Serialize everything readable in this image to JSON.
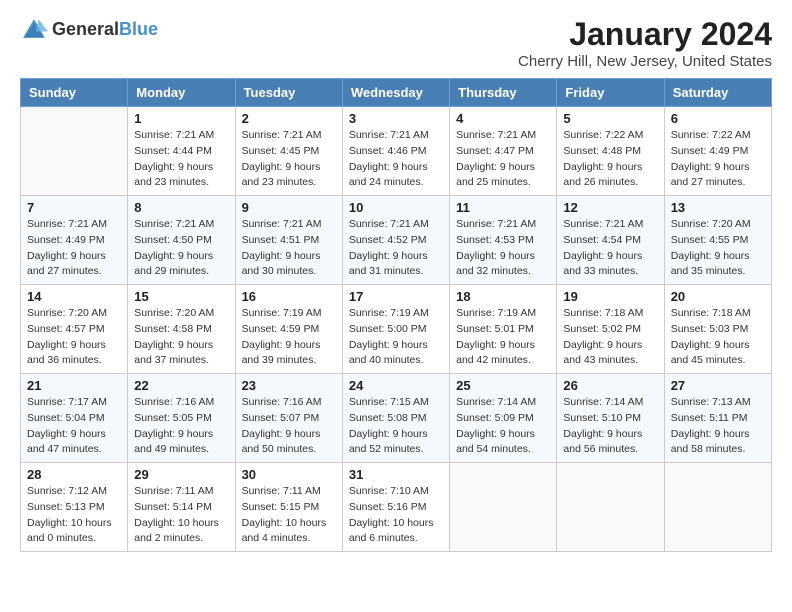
{
  "header": {
    "logo_general": "General",
    "logo_blue": "Blue",
    "title": "January 2024",
    "subtitle": "Cherry Hill, New Jersey, United States"
  },
  "days_of_week": [
    "Sunday",
    "Monday",
    "Tuesday",
    "Wednesday",
    "Thursday",
    "Friday",
    "Saturday"
  ],
  "weeks": [
    [
      {
        "day": "",
        "sunrise": "",
        "sunset": "",
        "daylight": ""
      },
      {
        "day": "1",
        "sunrise": "Sunrise: 7:21 AM",
        "sunset": "Sunset: 4:44 PM",
        "daylight": "Daylight: 9 hours and 23 minutes."
      },
      {
        "day": "2",
        "sunrise": "Sunrise: 7:21 AM",
        "sunset": "Sunset: 4:45 PM",
        "daylight": "Daylight: 9 hours and 23 minutes."
      },
      {
        "day": "3",
        "sunrise": "Sunrise: 7:21 AM",
        "sunset": "Sunset: 4:46 PM",
        "daylight": "Daylight: 9 hours and 24 minutes."
      },
      {
        "day": "4",
        "sunrise": "Sunrise: 7:21 AM",
        "sunset": "Sunset: 4:47 PM",
        "daylight": "Daylight: 9 hours and 25 minutes."
      },
      {
        "day": "5",
        "sunrise": "Sunrise: 7:22 AM",
        "sunset": "Sunset: 4:48 PM",
        "daylight": "Daylight: 9 hours and 26 minutes."
      },
      {
        "day": "6",
        "sunrise": "Sunrise: 7:22 AM",
        "sunset": "Sunset: 4:49 PM",
        "daylight": "Daylight: 9 hours and 27 minutes."
      }
    ],
    [
      {
        "day": "7",
        "sunrise": "Sunrise: 7:21 AM",
        "sunset": "Sunset: 4:49 PM",
        "daylight": "Daylight: 9 hours and 27 minutes."
      },
      {
        "day": "8",
        "sunrise": "Sunrise: 7:21 AM",
        "sunset": "Sunset: 4:50 PM",
        "daylight": "Daylight: 9 hours and 29 minutes."
      },
      {
        "day": "9",
        "sunrise": "Sunrise: 7:21 AM",
        "sunset": "Sunset: 4:51 PM",
        "daylight": "Daylight: 9 hours and 30 minutes."
      },
      {
        "day": "10",
        "sunrise": "Sunrise: 7:21 AM",
        "sunset": "Sunset: 4:52 PM",
        "daylight": "Daylight: 9 hours and 31 minutes."
      },
      {
        "day": "11",
        "sunrise": "Sunrise: 7:21 AM",
        "sunset": "Sunset: 4:53 PM",
        "daylight": "Daylight: 9 hours and 32 minutes."
      },
      {
        "day": "12",
        "sunrise": "Sunrise: 7:21 AM",
        "sunset": "Sunset: 4:54 PM",
        "daylight": "Daylight: 9 hours and 33 minutes."
      },
      {
        "day": "13",
        "sunrise": "Sunrise: 7:20 AM",
        "sunset": "Sunset: 4:55 PM",
        "daylight": "Daylight: 9 hours and 35 minutes."
      }
    ],
    [
      {
        "day": "14",
        "sunrise": "Sunrise: 7:20 AM",
        "sunset": "Sunset: 4:57 PM",
        "daylight": "Daylight: 9 hours and 36 minutes."
      },
      {
        "day": "15",
        "sunrise": "Sunrise: 7:20 AM",
        "sunset": "Sunset: 4:58 PM",
        "daylight": "Daylight: 9 hours and 37 minutes."
      },
      {
        "day": "16",
        "sunrise": "Sunrise: 7:19 AM",
        "sunset": "Sunset: 4:59 PM",
        "daylight": "Daylight: 9 hours and 39 minutes."
      },
      {
        "day": "17",
        "sunrise": "Sunrise: 7:19 AM",
        "sunset": "Sunset: 5:00 PM",
        "daylight": "Daylight: 9 hours and 40 minutes."
      },
      {
        "day": "18",
        "sunrise": "Sunrise: 7:19 AM",
        "sunset": "Sunset: 5:01 PM",
        "daylight": "Daylight: 9 hours and 42 minutes."
      },
      {
        "day": "19",
        "sunrise": "Sunrise: 7:18 AM",
        "sunset": "Sunset: 5:02 PM",
        "daylight": "Daylight: 9 hours and 43 minutes."
      },
      {
        "day": "20",
        "sunrise": "Sunrise: 7:18 AM",
        "sunset": "Sunset: 5:03 PM",
        "daylight": "Daylight: 9 hours and 45 minutes."
      }
    ],
    [
      {
        "day": "21",
        "sunrise": "Sunrise: 7:17 AM",
        "sunset": "Sunset: 5:04 PM",
        "daylight": "Daylight: 9 hours and 47 minutes."
      },
      {
        "day": "22",
        "sunrise": "Sunrise: 7:16 AM",
        "sunset": "Sunset: 5:05 PM",
        "daylight": "Daylight: 9 hours and 49 minutes."
      },
      {
        "day": "23",
        "sunrise": "Sunrise: 7:16 AM",
        "sunset": "Sunset: 5:07 PM",
        "daylight": "Daylight: 9 hours and 50 minutes."
      },
      {
        "day": "24",
        "sunrise": "Sunrise: 7:15 AM",
        "sunset": "Sunset: 5:08 PM",
        "daylight": "Daylight: 9 hours and 52 minutes."
      },
      {
        "day": "25",
        "sunrise": "Sunrise: 7:14 AM",
        "sunset": "Sunset: 5:09 PM",
        "daylight": "Daylight: 9 hours and 54 minutes."
      },
      {
        "day": "26",
        "sunrise": "Sunrise: 7:14 AM",
        "sunset": "Sunset: 5:10 PM",
        "daylight": "Daylight: 9 hours and 56 minutes."
      },
      {
        "day": "27",
        "sunrise": "Sunrise: 7:13 AM",
        "sunset": "Sunset: 5:11 PM",
        "daylight": "Daylight: 9 hours and 58 minutes."
      }
    ],
    [
      {
        "day": "28",
        "sunrise": "Sunrise: 7:12 AM",
        "sunset": "Sunset: 5:13 PM",
        "daylight": "Daylight: 10 hours and 0 minutes."
      },
      {
        "day": "29",
        "sunrise": "Sunrise: 7:11 AM",
        "sunset": "Sunset: 5:14 PM",
        "daylight": "Daylight: 10 hours and 2 minutes."
      },
      {
        "day": "30",
        "sunrise": "Sunrise: 7:11 AM",
        "sunset": "Sunset: 5:15 PM",
        "daylight": "Daylight: 10 hours and 4 minutes."
      },
      {
        "day": "31",
        "sunrise": "Sunrise: 7:10 AM",
        "sunset": "Sunset: 5:16 PM",
        "daylight": "Daylight: 10 hours and 6 minutes."
      },
      {
        "day": "",
        "sunrise": "",
        "sunset": "",
        "daylight": ""
      },
      {
        "day": "",
        "sunrise": "",
        "sunset": "",
        "daylight": ""
      },
      {
        "day": "",
        "sunrise": "",
        "sunset": "",
        "daylight": ""
      }
    ]
  ]
}
